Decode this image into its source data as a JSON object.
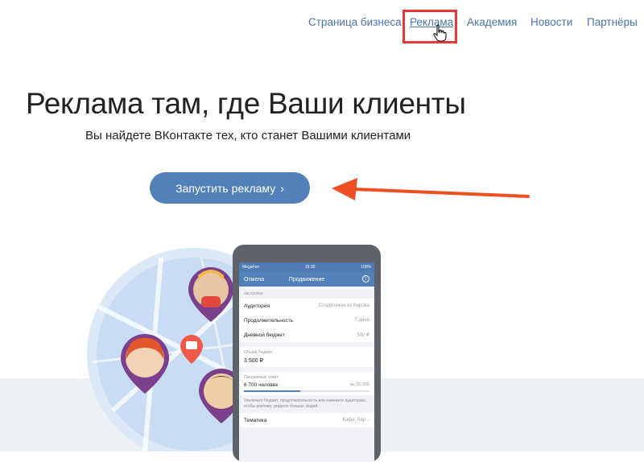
{
  "nav": {
    "items": [
      {
        "label": "Страница бизнеса"
      },
      {
        "label": "Реклама"
      },
      {
        "label": "Академия"
      },
      {
        "label": "Новости"
      },
      {
        "label": "Партнёры"
      }
    ]
  },
  "hero": {
    "title": "Реклама там, где Ваши клиенты",
    "subtitle": "Вы найдете ВКонтакте тех, кто станет Вашими клиентами",
    "cta_label": "Запустить рекламу",
    "cta_chevron": "›"
  },
  "phone": {
    "status": {
      "carrier": "MegaFon",
      "time": "16:30",
      "battery": "100%"
    },
    "header": {
      "back": "Отмена",
      "title": "Продвижение",
      "info": "i"
    },
    "section_caption": "настройки",
    "settings": [
      {
        "label": "Аудитория",
        "value": "Сладкоежки из Кирова"
      },
      {
        "label": "Продолжительность",
        "value": "7 дней"
      },
      {
        "label": "Дневной бюджет",
        "value": "500 ₽"
      }
    ],
    "budget": {
      "caption": "Общий бюджет",
      "value": "3 500 ₽"
    },
    "reach": {
      "caption": "Ожидаемый охват",
      "value": "6 700 человек",
      "of": "из 15 000",
      "fill_fraction": 0.45
    },
    "hint": "Увеличьте бюджет, продолжительность или измените аудиторию, чтобы рекламу увидело больше людей.",
    "topic": {
      "label": "Тематика",
      "value": "Кафе, бар..."
    }
  },
  "colors": {
    "link": "#4a76a8",
    "button": "#5181b8",
    "arrow": "#f04e23",
    "highlight": "#e53935"
  },
  "icons": [
    "cursor-hand-icon",
    "chevron-right-icon",
    "info-icon",
    "location-pin-icon",
    "coffee-cup-icon"
  ]
}
